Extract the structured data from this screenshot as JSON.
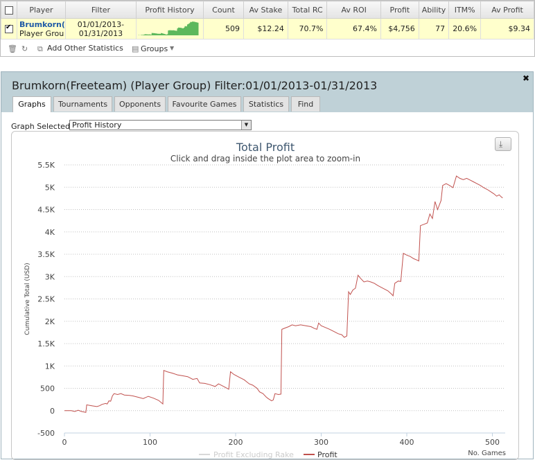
{
  "stats_table": {
    "columns": [
      "Player",
      "Filter",
      "Profit History",
      "Count",
      "Av Stake",
      "Total RC",
      "Av ROI",
      "Profit",
      "Ability",
      "ITM%",
      "Av Profit"
    ],
    "row": {
      "player_name": "Brumkorn(",
      "player_group": "Player Grou",
      "filter_line1": "01/01/2013-",
      "filter_line2": "01/31/2013",
      "count": "509",
      "av_stake": "$12.24",
      "total_rc": "70.7%",
      "av_roi": "67.4%",
      "profit": "$4,756",
      "ability": "77",
      "itm": "20.6%",
      "av_profit": "$9.34"
    },
    "sparkline_color": "#5cb85c"
  },
  "toolbar": {
    "icons": [
      "trash-icon",
      "refresh-icon",
      "add-stats-icon",
      "groups-icon"
    ],
    "add_stats_label": "Add Other Statistics",
    "groups_label": "Groups"
  },
  "panel": {
    "title": "Brumkorn(Freeteam) (Player Group) Filter:01/01/2013-01/31/2013",
    "tabs": [
      "Graphs",
      "Tournaments",
      "Opponents",
      "Favourite Games",
      "Statistics",
      "Find"
    ],
    "active_tab": "Graphs",
    "graph_selected_label": "Graph Selected:",
    "graph_selected_value": "Profit History"
  },
  "chart_data": {
    "type": "line",
    "title": "Total Profit",
    "subtitle": "Click and drag inside the plot area to zoom-in",
    "ylabel": "Cumulative Total (USD)",
    "xlabel": "No. Games",
    "ylim": [
      -500,
      5500
    ],
    "xlim": [
      0,
      515
    ],
    "yticks": [
      "-500",
      "0",
      "500",
      "1K",
      "1.5K",
      "2K",
      "2.5K",
      "3K",
      "3.5K",
      "4K",
      "4.5K",
      "5K",
      "5.5K"
    ],
    "xticks": [
      "0",
      "100",
      "200",
      "300",
      "400",
      "500"
    ],
    "grid": true,
    "legend_position": "bottom-center",
    "series": [
      {
        "name": "Profit Excluding Rake",
        "color": "#d8d8d8",
        "hidden": true,
        "points": []
      },
      {
        "name": "Profit",
        "color": "#c0504d",
        "hidden": false,
        "points": [
          [
            0,
            0
          ],
          [
            8,
            0
          ],
          [
            12,
            -20
          ],
          [
            16,
            10
          ],
          [
            20,
            -20
          ],
          [
            25,
            -40
          ],
          [
            26,
            130
          ],
          [
            32,
            110
          ],
          [
            38,
            90
          ],
          [
            41,
            110
          ],
          [
            44,
            140
          ],
          [
            48,
            160
          ],
          [
            50,
            150
          ],
          [
            52,
            220
          ],
          [
            54,
            210
          ],
          [
            56,
            330
          ],
          [
            58,
            380
          ],
          [
            62,
            360
          ],
          [
            66,
            380
          ],
          [
            70,
            350
          ],
          [
            76,
            340
          ],
          [
            80,
            330
          ],
          [
            86,
            300
          ],
          [
            92,
            270
          ],
          [
            98,
            320
          ],
          [
            104,
            280
          ],
          [
            110,
            230
          ],
          [
            115,
            150
          ],
          [
            116,
            900
          ],
          [
            120,
            870
          ],
          [
            126,
            840
          ],
          [
            132,
            800
          ],
          [
            138,
            780
          ],
          [
            144,
            760
          ],
          [
            150,
            700
          ],
          [
            155,
            720
          ],
          [
            158,
            620
          ],
          [
            164,
            610
          ],
          [
            170,
            580
          ],
          [
            176,
            540
          ],
          [
            180,
            600
          ],
          [
            184,
            560
          ],
          [
            188,
            520
          ],
          [
            192,
            480
          ],
          [
            194,
            870
          ],
          [
            198,
            810
          ],
          [
            204,
            750
          ],
          [
            210,
            690
          ],
          [
            216,
            600
          ],
          [
            220,
            570
          ],
          [
            225,
            500
          ],
          [
            228,
            420
          ],
          [
            232,
            380
          ],
          [
            236,
            300
          ],
          [
            238,
            270
          ],
          [
            242,
            220
          ],
          [
            244,
            240
          ],
          [
            246,
            380
          ],
          [
            250,
            360
          ],
          [
            253,
            370
          ],
          [
            254,
            1820
          ],
          [
            258,
            1850
          ],
          [
            262,
            1880
          ],
          [
            266,
            1920
          ],
          [
            270,
            1900
          ],
          [
            276,
            1920
          ],
          [
            282,
            1900
          ],
          [
            288,
            1880
          ],
          [
            292,
            1840
          ],
          [
            295,
            1820
          ],
          [
            297,
            1960
          ],
          [
            300,
            1900
          ],
          [
            305,
            1860
          ],
          [
            310,
            1820
          ],
          [
            316,
            1760
          ],
          [
            320,
            1720
          ],
          [
            324,
            1700
          ],
          [
            327,
            1640
          ],
          [
            330,
            1670
          ],
          [
            332,
            2660
          ],
          [
            334,
            2600
          ],
          [
            337,
            2700
          ],
          [
            340,
            2740
          ],
          [
            343,
            3030
          ],
          [
            346,
            2960
          ],
          [
            350,
            2880
          ],
          [
            354,
            2900
          ],
          [
            358,
            2880
          ],
          [
            362,
            2850
          ],
          [
            366,
            2800
          ],
          [
            370,
            2760
          ],
          [
            374,
            2720
          ],
          [
            378,
            2680
          ],
          [
            382,
            2610
          ],
          [
            384,
            2570
          ],
          [
            386,
            2850
          ],
          [
            390,
            2900
          ],
          [
            393,
            2890
          ],
          [
            396,
            3520
          ],
          [
            400,
            3480
          ],
          [
            404,
            3450
          ],
          [
            408,
            3400
          ],
          [
            412,
            3370
          ],
          [
            414,
            3350
          ],
          [
            416,
            4140
          ],
          [
            420,
            4170
          ],
          [
            424,
            4200
          ],
          [
            427,
            4400
          ],
          [
            430,
            4300
          ],
          [
            433,
            4680
          ],
          [
            436,
            4500
          ],
          [
            440,
            4700
          ],
          [
            442,
            5040
          ],
          [
            446,
            5080
          ],
          [
            450,
            5040
          ],
          [
            454,
            4990
          ],
          [
            458,
            5250
          ],
          [
            462,
            5200
          ],
          [
            466,
            5170
          ],
          [
            470,
            5200
          ],
          [
            474,
            5160
          ],
          [
            478,
            5120
          ],
          [
            482,
            5080
          ],
          [
            486,
            5040
          ],
          [
            490,
            4990
          ],
          [
            494,
            4950
          ],
          [
            498,
            4900
          ],
          [
            502,
            4850
          ],
          [
            505,
            4800
          ],
          [
            508,
            4830
          ],
          [
            510,
            4790
          ],
          [
            512,
            4760
          ]
        ]
      }
    ]
  }
}
